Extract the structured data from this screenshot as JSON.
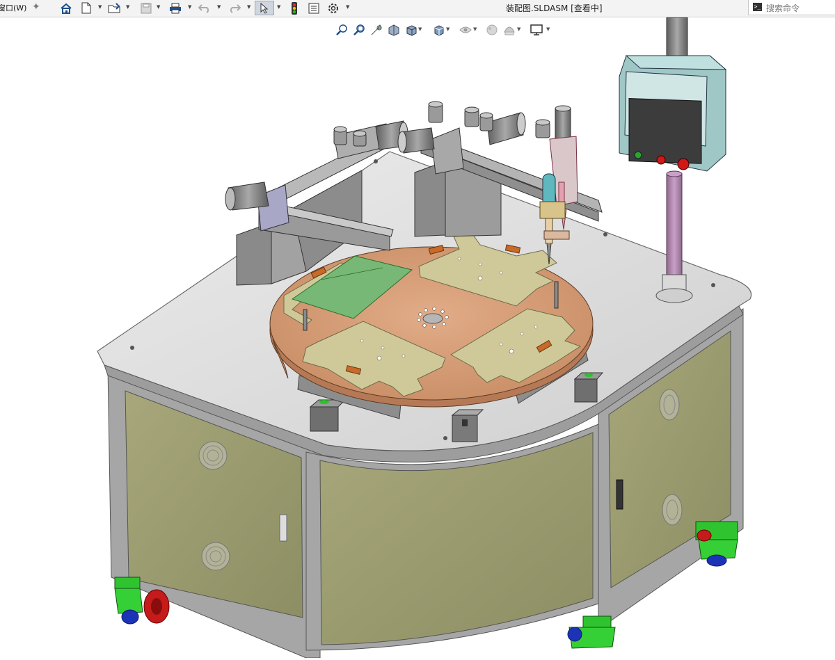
{
  "menu": {
    "window_label": "窗口(W)"
  },
  "window": {
    "title": "装配图.SLDASM [查看中]"
  },
  "search": {
    "placeholder": "搜索命令",
    "icon": "terminal-icon"
  },
  "toolbar": {
    "icons": [
      "home-icon",
      "new-document-icon",
      "open-folder-icon",
      "save-icon",
      "print-icon",
      "undo-icon",
      "redo-icon",
      "select-pointer-icon",
      "traffic-light-icon",
      "file-properties-icon",
      "options-gear-icon"
    ]
  },
  "view_toolbar": {
    "icons": [
      "zoom-to-fit-icon",
      "zoom-to-area-icon",
      "previous-view-icon",
      "section-view-icon",
      "view-orientation-icon",
      "display-style-icon",
      "hide-show-icon",
      "edit-appearance-icon",
      "apply-scene-icon",
      "view-settings-icon"
    ]
  },
  "colors": {
    "table_top": "#d8d8d8",
    "cabinet_panel": "#9e9e72",
    "frame": "#9a9a9a",
    "turntable": "#d59a73",
    "fixture": "#cfc99a",
    "pcb": "#77b877",
    "caster": "#2fc42f",
    "hmi_body": "#9fc7c5",
    "column": "#b68ab5"
  }
}
